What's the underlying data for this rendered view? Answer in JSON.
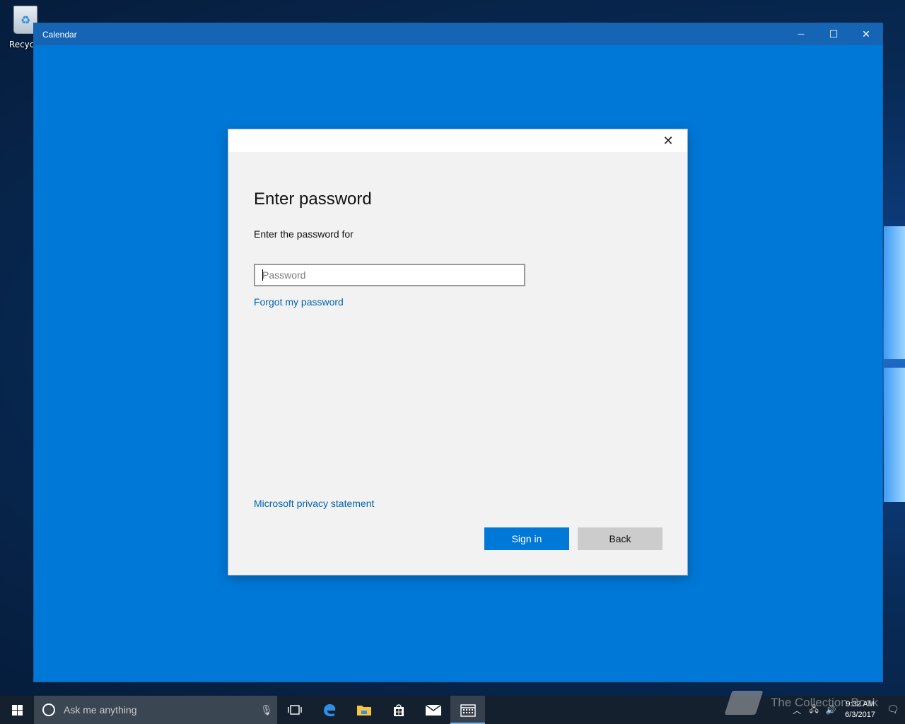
{
  "desktop": {
    "recycle_bin_label": "Recycle"
  },
  "window": {
    "title": "Calendar",
    "minimize_glyph": "—",
    "maximize_glyph": "☐",
    "close_glyph": "✕"
  },
  "dialog": {
    "close_glyph": "✕",
    "heading": "Enter password",
    "subtitle": "Enter the password for",
    "password_placeholder": "Password",
    "password_value": "",
    "forgot_link": "Forgot my password",
    "privacy_link": "Microsoft privacy statement",
    "sign_in_label": "Sign in",
    "back_label": "Back"
  },
  "taskbar": {
    "search_placeholder": "Ask me anything",
    "pinned": [
      "task-view-icon",
      "edge-icon",
      "file-explorer-icon",
      "store-icon",
      "mail-icon",
      "calendar-icon"
    ],
    "active_app": "calendar-icon",
    "time": "9:32 AM",
    "date": "6/3/2017"
  },
  "watermark": {
    "text": "The Collection Book"
  },
  "colors": {
    "window_bg": "#0078d7",
    "titlebar": "#1565b4",
    "accent_button": "#0078d7",
    "link": "#0063b1",
    "taskbar": "#14202e"
  }
}
